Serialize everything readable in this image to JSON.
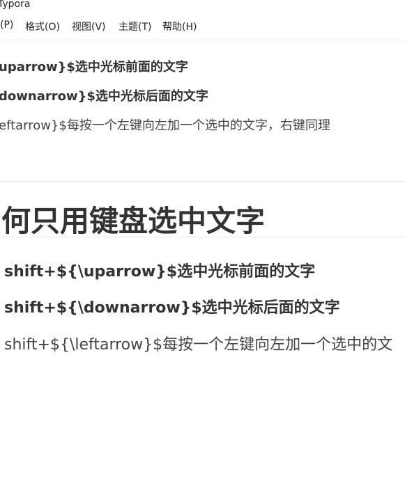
{
  "window": {
    "title": "Typora"
  },
  "menu": [
    {
      "label": "(P)"
    },
    {
      "label": "格式(O)"
    },
    {
      "label": "视图(V)"
    },
    {
      "label": "主题(T)"
    },
    {
      "label": "帮助(H)"
    }
  ],
  "preview": {
    "lines": [
      "uparrow}$选中光标前面的文字",
      "downarrow}$选中光标后面的文字",
      "eftarrow}$每按一个左键向左加一个选中的文字，右键同理"
    ]
  },
  "main": {
    "heading": "何只用键盘选中文字",
    "lines": [
      "shift+${\\uparrow}$选中光标前面的文字",
      "shift+${\\downarrow}$选中光标后面的文字",
      "shift+${\\leftarrow}$每按一个左键向左加一个选中的文"
    ]
  }
}
